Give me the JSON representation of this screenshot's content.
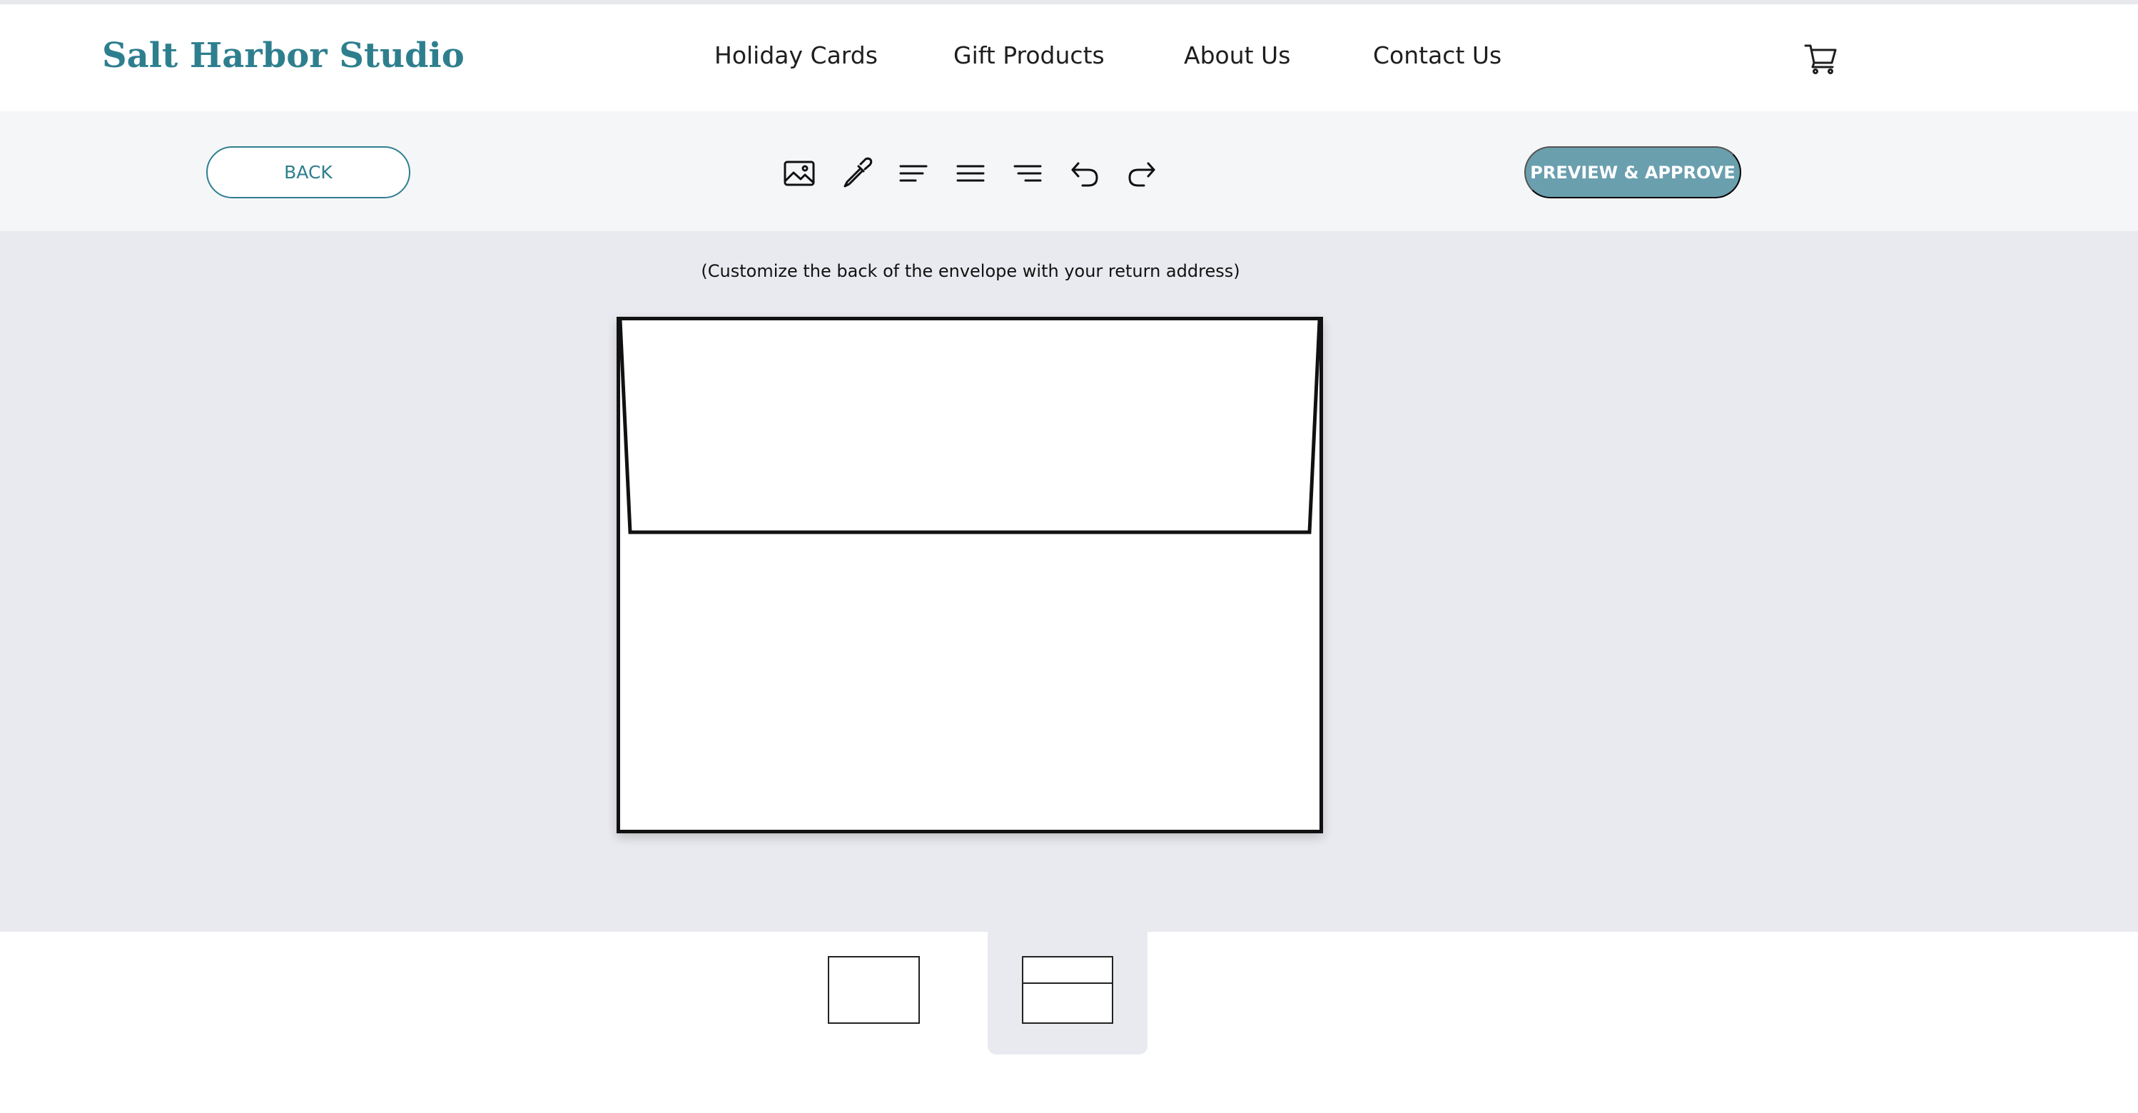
{
  "header": {
    "logo": "Salt Harbor Studio",
    "nav": [
      {
        "label": "Holiday Cards"
      },
      {
        "label": "Gift Products"
      },
      {
        "label": "About Us"
      },
      {
        "label": "Contact Us"
      }
    ],
    "cart_icon": "cart-icon"
  },
  "toolbar": {
    "back_label": "BACK",
    "preview_label": "PREVIEW & APPROVE",
    "tools": [
      "image-icon",
      "eyedropper-icon",
      "align-left-icon",
      "align-center-icon",
      "align-right-icon",
      "undo-icon",
      "redo-icon"
    ]
  },
  "editor": {
    "instruction": "(Customize the back of the envelope with your return address)"
  },
  "thumbnails": {
    "items": [
      "envelope-front-thumbnail",
      "envelope-back-thumbnail"
    ],
    "selected": "envelope-back-thumbnail"
  },
  "colors": {
    "brand": "#2e7f8e",
    "primary_button": "#6a9fae",
    "canvas_bg": "#e9eaef",
    "toolbar_bg": "#f5f6f8"
  }
}
